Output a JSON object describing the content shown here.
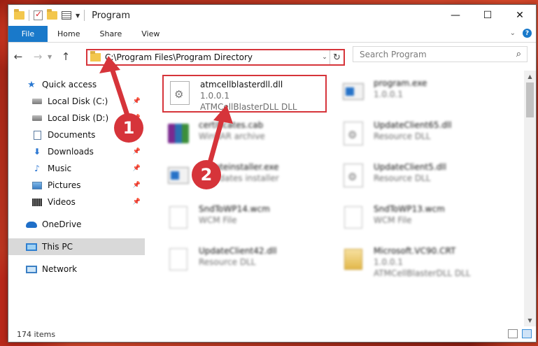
{
  "window": {
    "title": "Program",
    "controls": [
      "—",
      "☐",
      "✕"
    ]
  },
  "ribbon": {
    "file": "File",
    "tabs": [
      "Home",
      "Share",
      "View"
    ]
  },
  "navigation": {
    "path": "C:\\Program Files\\Program Directory",
    "search_placeholder": "Search Program"
  },
  "sidebar": {
    "quick_access": "Quick access",
    "items": [
      {
        "label": "Local Disk (C:)",
        "icon": "disk-icon",
        "pinned": true
      },
      {
        "label": "Local Disk (D:)",
        "icon": "disk-icon",
        "pinned": true
      },
      {
        "label": "Documents",
        "icon": "documents-icon",
        "pinned": true
      },
      {
        "label": "Downloads",
        "icon": "downloads-icon",
        "pinned": true
      },
      {
        "label": "Music",
        "icon": "music-icon",
        "pinned": true
      },
      {
        "label": "Pictures",
        "icon": "pictures-icon",
        "pinned": true
      },
      {
        "label": "Videos",
        "icon": "videos-icon",
        "pinned": true
      }
    ],
    "onedrive": "OneDrive",
    "this_pc": "This PC",
    "network": "Network"
  },
  "files": [
    {
      "name": "atmcellblasterdll.dll",
      "line2": "1.0.0.1",
      "line3": "ATMCellBlasterDLL DLL",
      "highlighted": true
    },
    {
      "name": "program.exe",
      "line2": "1.0.0.1",
      "line3": ""
    },
    {
      "name": "certificates.cab",
      "line2": "WinRAR archive",
      "line3": ""
    },
    {
      "name": "UpdateClient65.dll",
      "line2": "Resource DLL",
      "line3": ""
    },
    {
      "name": "updateinstaller.exe",
      "line2": "Pi updates installer",
      "line3": ""
    },
    {
      "name": "UpdateClient5.dll",
      "line2": "Resource DLL",
      "line3": ""
    },
    {
      "name": "SndToWP14.wcm",
      "line2": "WCM File",
      "line3": ""
    },
    {
      "name": "SndToWP13.wcm",
      "line2": "WCM File",
      "line3": ""
    },
    {
      "name": "UpdateClient42.dll",
      "line2": "Resource DLL",
      "line3": ""
    },
    {
      "name": "Microsoft.VC90.CRT",
      "line2": "1.0.0.1",
      "line3": "ATMCellBlasterDLL DLL"
    }
  ],
  "status": {
    "count": "174 items"
  },
  "annotations": {
    "step1": "1",
    "step2": "2",
    "color": "#d6343a"
  }
}
